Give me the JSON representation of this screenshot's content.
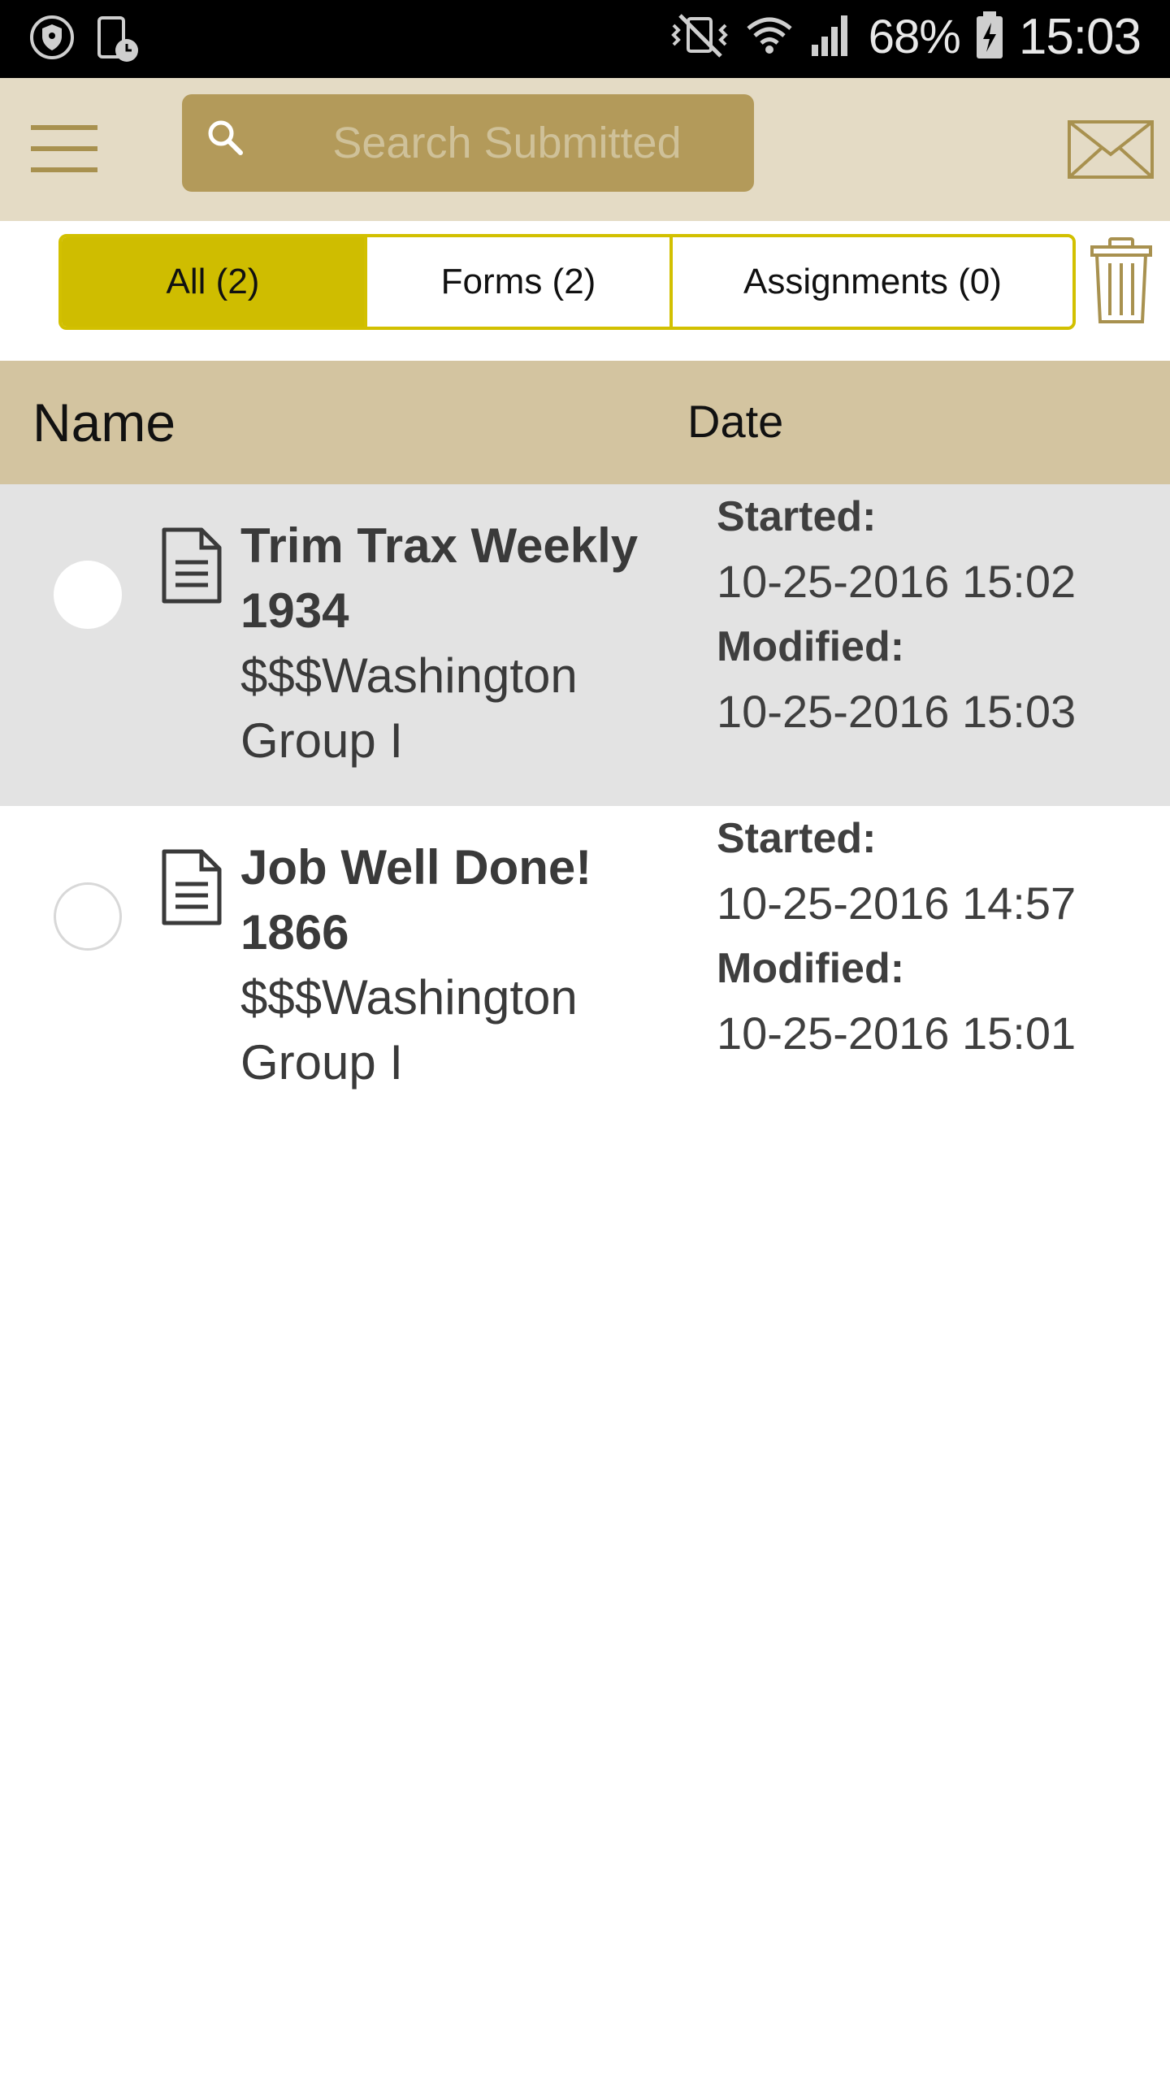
{
  "status_bar": {
    "battery_percent": "68%",
    "time": "15:03",
    "icons": [
      "shield-icon",
      "device-clock-icon",
      "vibrate-mute-icon",
      "wifi-icon",
      "signal-icon",
      "battery-charging-icon"
    ]
  },
  "header": {
    "search_placeholder": "Search Submitted",
    "icons": [
      "hamburger-menu-icon",
      "search-icon",
      "envelope-icon"
    ]
  },
  "tabs": [
    {
      "label": "All (2)",
      "active": true
    },
    {
      "label": "Forms (2)",
      "active": false
    },
    {
      "label": "Assignments (0)",
      "active": false
    }
  ],
  "table": {
    "columns": {
      "name": "Name",
      "date": "Date"
    },
    "rows": [
      {
        "title": "Trim Trax Weekly 1934",
        "subtitle": "$$$Washington Group I",
        "started_label": "Started:",
        "started": "10-25-2016 15:02",
        "modified_label": "Modified:",
        "modified": "10-25-2016 15:03",
        "highlighted": true
      },
      {
        "title": "Job Well Done! 1866",
        "subtitle": "$$$Washington Group I",
        "started_label": "Started:",
        "started": "10-25-2016 14:57",
        "modified_label": "Modified:",
        "modified": "10-25-2016 15:01",
        "highlighted": false
      }
    ]
  },
  "colors": {
    "header_bg": "#e4dbc5",
    "search_bg": "#b39a5a",
    "accent_gold": "#b39a5a",
    "active_tab": "#cfbd00",
    "table_header_bg": "#d3c4a0",
    "selected_row_bg": "#e3e3e3"
  }
}
